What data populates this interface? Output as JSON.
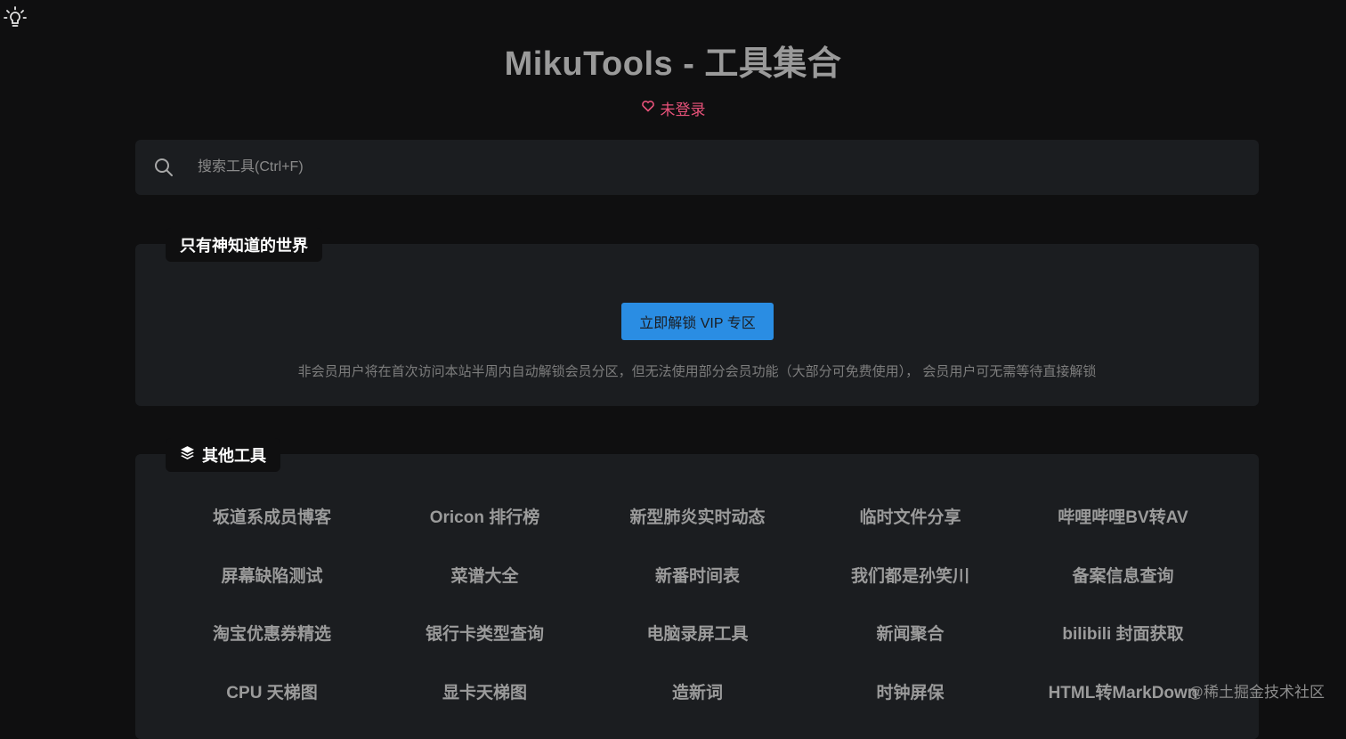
{
  "header": {
    "title": "MikuTools - 工具集合",
    "login_label": "未登录"
  },
  "search": {
    "placeholder": "搜索工具(Ctrl+F)",
    "value": ""
  },
  "vip_section": {
    "label": "只有神知道的世界",
    "unlock_button": "立即解锁 VIP 专区",
    "note": "非会员用户将在首次访问本站半周内自动解锁会员分区，但无法使用部分会员功能（大部分可免费使用）， 会员用户可无需等待直接解锁"
  },
  "tools_section": {
    "label": "其他工具",
    "items": [
      {
        "label": "坂道系成员博客"
      },
      {
        "label": "Oricon 排行榜"
      },
      {
        "label": "新型肺炎实时动态"
      },
      {
        "label": "临时文件分享"
      },
      {
        "label": "哔哩哔哩BV转AV"
      },
      {
        "label": "屏幕缺陷测试"
      },
      {
        "label": "菜谱大全"
      },
      {
        "label": "新番时间表"
      },
      {
        "label": "我们都是孙笑川"
      },
      {
        "label": "备案信息查询"
      },
      {
        "label": "淘宝优惠券精选"
      },
      {
        "label": "银行卡类型查询"
      },
      {
        "label": "电脑录屏工具"
      },
      {
        "label": "新闻聚合"
      },
      {
        "label": "bilibili 封面获取"
      },
      {
        "label": "CPU 天梯图"
      },
      {
        "label": "显卡天梯图"
      },
      {
        "label": "造新词"
      },
      {
        "label": "时钟屏保"
      },
      {
        "label": "HTML转MarkDown"
      }
    ]
  },
  "watermark": "@稀土掘金技术社区",
  "colors": {
    "background": "#0f0f10",
    "panel": "#1b1d20",
    "accent": "#2a8de3",
    "login": "#e8527a"
  },
  "icons": {
    "theme_toggle": "lightbulb-icon",
    "login": "heart-icon",
    "search": "search-icon",
    "tools_section": "layers-icon"
  }
}
